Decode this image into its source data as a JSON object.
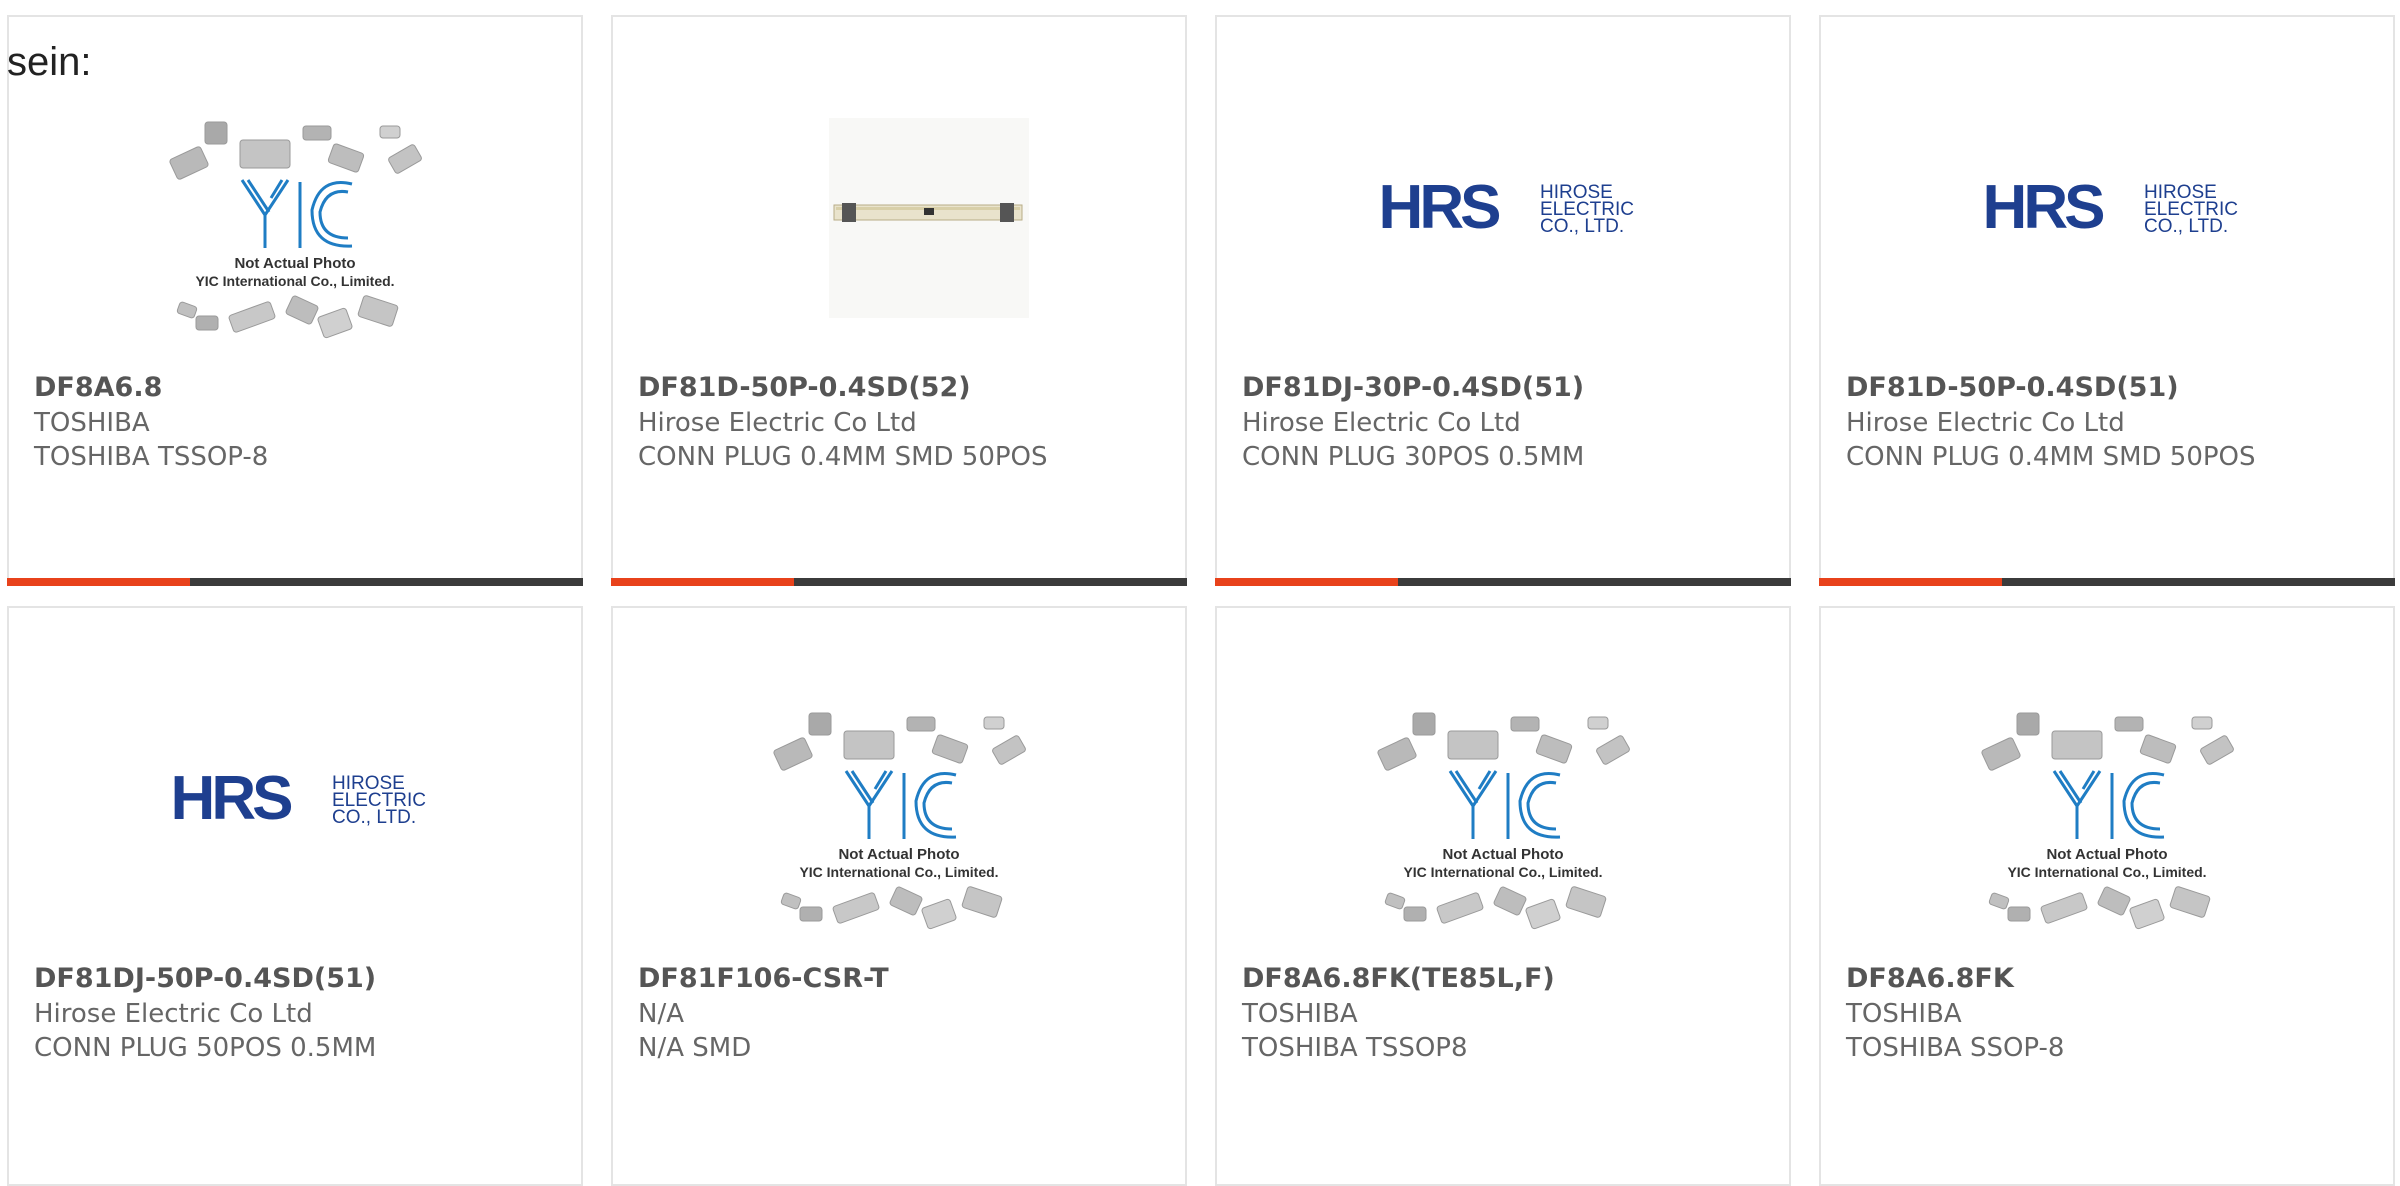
{
  "lead_text": "sein:",
  "colors": {
    "accent": "#e8421b",
    "bar": "#3b3b3b",
    "hrs_blue": "#1e3f8f",
    "yic_blue": "#1f7dc4"
  },
  "placeholder": {
    "caption_line1": "Not Actual Photo",
    "caption_line2": "YIC International Co., Limited.",
    "logo": "YIC"
  },
  "hirose_logo": {
    "mark": "HRS",
    "line1": "HIROSE",
    "line2": "ELECTRIC",
    "line3": "CO., LTD."
  },
  "products": [
    {
      "part_number": "DF8A6.8",
      "manufacturer": "TOSHIBA",
      "description": "TOSHIBA TSSOP-8",
      "image": "yic-placeholder",
      "accent_bar": true
    },
    {
      "part_number": "DF81D-50P-0.4SD(52)",
      "manufacturer": "Hirose Electric Co Ltd",
      "description": "CONN PLUG 0.4MM SMD 50POS",
      "image": "connector-photo",
      "accent_bar": true
    },
    {
      "part_number": "DF81DJ-30P-0.4SD(51)",
      "manufacturer": "Hirose Electric Co Ltd",
      "description": "CONN PLUG 30POS 0.5MM",
      "image": "hirose-logo",
      "accent_bar": true
    },
    {
      "part_number": "DF81D-50P-0.4SD(51)",
      "manufacturer": "Hirose Electric Co Ltd",
      "description": "CONN PLUG 0.4MM SMD 50POS",
      "image": "hirose-logo",
      "accent_bar": true
    },
    {
      "part_number": "DF81DJ-50P-0.4SD(51)",
      "manufacturer": "Hirose Electric Co Ltd",
      "description": "CONN PLUG 50POS 0.5MM",
      "image": "hirose-logo",
      "accent_bar": false
    },
    {
      "part_number": "DF81F106-CSR-T",
      "manufacturer": "N/A",
      "description": "N/A SMD",
      "image": "yic-placeholder",
      "accent_bar": false
    },
    {
      "part_number": "DF8A6.8FK(TE85L,F)",
      "manufacturer": "TOSHIBA",
      "description": "TOSHIBA TSSOP8",
      "image": "yic-placeholder",
      "accent_bar": false
    },
    {
      "part_number": "DF8A6.8FK",
      "manufacturer": "TOSHIBA",
      "description": "TOSHIBA SSOP-8",
      "image": "yic-placeholder",
      "accent_bar": false
    }
  ]
}
